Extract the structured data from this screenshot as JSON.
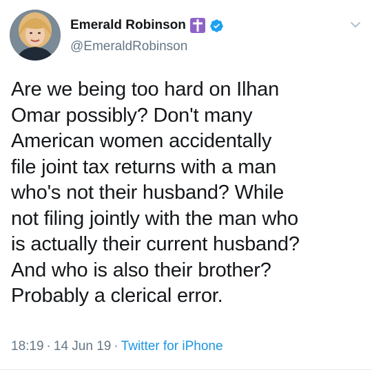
{
  "user": {
    "display_name": "Emerald Robinson",
    "handle": "@EmeraldRobinson",
    "badges": [
      "cross-emoji-icon",
      "verified-badge-icon"
    ]
  },
  "tweet": {
    "text": "Are we being too hard on Ilhan\nOmar possibly? Don't many\nAmerican women accidentally\nfile joint tax returns with a man\nwho's not their husband? While\nnot filing jointly with the man who\nis actually their current husband?\nAnd who is also their brother?\nProbably a clerical error.",
    "time": "18:19",
    "date": "14 Jun 19",
    "source": "Twitter for iPhone",
    "separator": "·"
  },
  "colors": {
    "text": "#14171a",
    "secondary": "#657786",
    "link": "#1b95e0",
    "verified": "#1da1f2",
    "cross_badge": "#8e63c7"
  },
  "icons": {
    "menu": "chevron-down-icon"
  }
}
